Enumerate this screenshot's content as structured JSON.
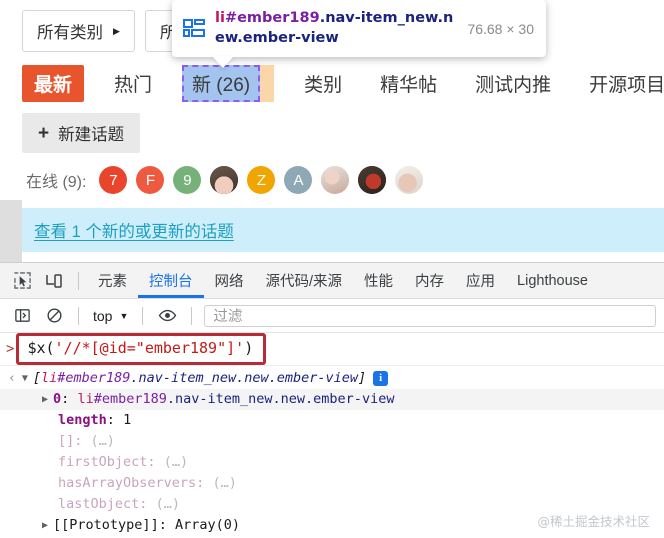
{
  "page": {
    "dropdowns": [
      {
        "label": "所有类别",
        "caret": "▶"
      },
      {
        "label": "所有",
        "caret": "▶"
      }
    ],
    "nav_tabs": [
      {
        "label": "最新",
        "state": "active"
      },
      {
        "label": "热门",
        "state": "normal"
      },
      {
        "label": "新 (26)",
        "state": "inspected"
      },
      {
        "label": "类别",
        "state": "normal"
      },
      {
        "label": "精华帖",
        "state": "normal"
      },
      {
        "label": "测试内推",
        "state": "normal"
      },
      {
        "label": "开源项目",
        "state": "normal"
      }
    ],
    "new_topic_button": {
      "plus": "+",
      "label": "新建话题"
    },
    "online": {
      "label": "在线 (9):",
      "avatars": [
        {
          "text": "7",
          "color": "#e8452c",
          "kind": "text"
        },
        {
          "text": "F",
          "color": "#ed5a3f",
          "kind": "text"
        },
        {
          "text": "9",
          "color": "#76b17a",
          "kind": "text"
        },
        {
          "text": "",
          "color": "#4a3a2d",
          "kind": "photo"
        },
        {
          "text": "Z",
          "color": "#f0a500",
          "kind": "text"
        },
        {
          "text": "A",
          "color": "#8fa8b5",
          "kind": "text"
        },
        {
          "text": "",
          "color": "#e8cdc0",
          "kind": "photo2"
        },
        {
          "text": "",
          "color": "#3a2e26",
          "kind": "photo3"
        },
        {
          "text": "",
          "color": "#efe9e2",
          "kind": "photo4"
        }
      ]
    },
    "notification": {
      "text": "查看 1 个新的或更新的话题",
      "bg": "#cfeefb",
      "color": "#1e9fbf"
    }
  },
  "inspect_tooltip": {
    "tag": "li",
    "id": "#ember189",
    "classes": ".nav-item_new.new.ember-view",
    "dimensions": "76.68 × 30",
    "icon": "grid-layout-icon"
  },
  "devtools": {
    "tabs": [
      {
        "label": "元素",
        "selected": false
      },
      {
        "label": "控制台",
        "selected": true
      },
      {
        "label": "网络",
        "selected": false
      },
      {
        "label": "源代码/来源",
        "selected": false
      },
      {
        "label": "性能",
        "selected": false
      },
      {
        "label": "内存",
        "selected": false
      },
      {
        "label": "应用",
        "selected": false
      },
      {
        "label": "Lighthouse",
        "selected": false
      }
    ],
    "toolbar": {
      "context": "top",
      "context_caret": "▼",
      "filter_placeholder": "过滤"
    },
    "console": {
      "prompt": ">",
      "command": {
        "fn_open": "$x(",
        "string": "'//*[@id=\"ember189\"]'",
        "fn_close": ")"
      },
      "result": {
        "back_arrow": "‹",
        "triangle": "▼",
        "open_bracket": "[",
        "tag": "li",
        "id": "#ember189",
        "classes": ".nav-item_new.new.ember-view",
        "close_bracket": "]",
        "info_badge": "i"
      },
      "index_row": {
        "triangle": "▶",
        "key": "0",
        "colon": ":",
        "tag": "li",
        "id": "#ember189",
        "classes": ".nav-item_new.new.ember-view"
      },
      "properties": [
        {
          "key": "length",
          "sep": ":",
          "value": "1",
          "style": "number"
        },
        {
          "key": "[]",
          "sep": ":",
          "value": "(…)",
          "style": "dim"
        },
        {
          "key": "firstObject",
          "sep": ":",
          "value": "(…)",
          "style": "dim"
        },
        {
          "key": "hasArrayObservers",
          "sep": ":",
          "value": "(…)",
          "style": "dim"
        },
        {
          "key": "lastObject",
          "sep": ":",
          "value": "(…)",
          "style": "dim"
        }
      ],
      "prototype_row": {
        "triangle": "▶",
        "key": "[[Prototype]]",
        "sep": ":",
        "value": "Array(0)"
      }
    }
  },
  "watermark": "@稀土掘金技术社区"
}
